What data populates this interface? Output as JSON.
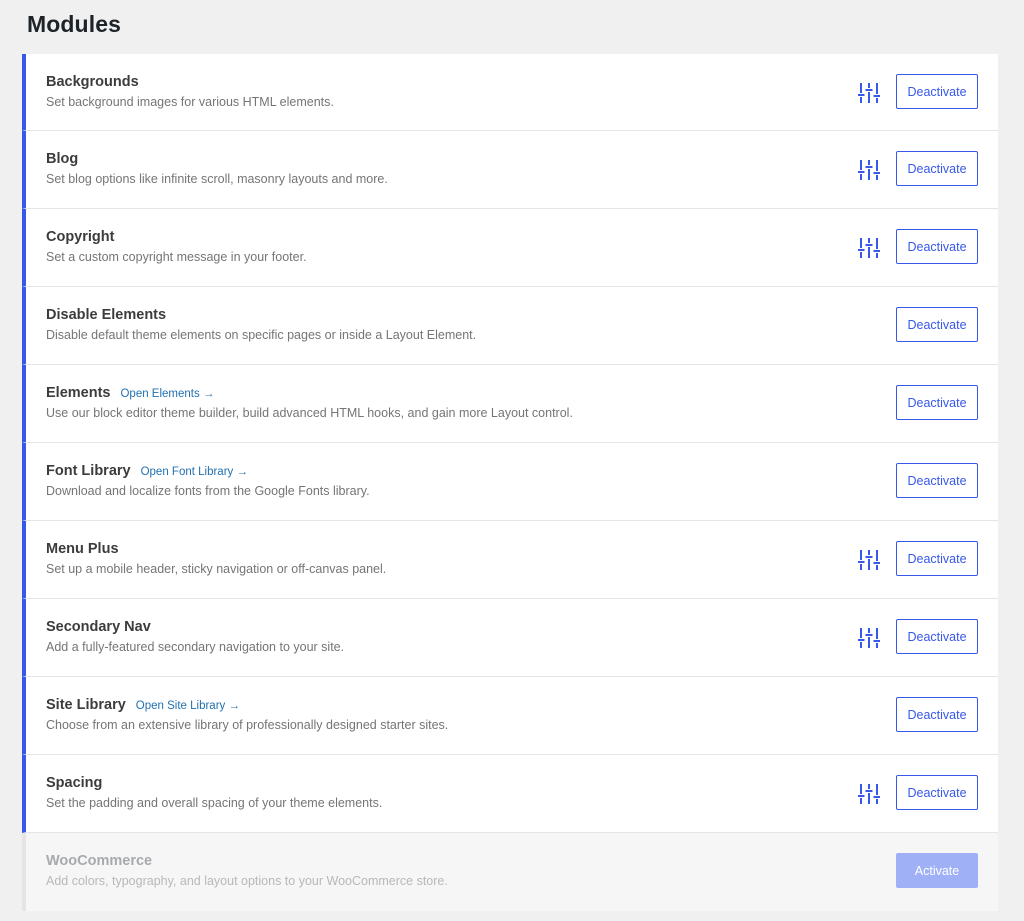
{
  "page": {
    "title": "Modules"
  },
  "colors": {
    "accent": "#3858e9",
    "inactive_button": "#9fb0f7",
    "link": "#2271b1"
  },
  "modules": [
    {
      "name": "Backgrounds",
      "description": "Set background images for various HTML elements.",
      "link": "",
      "has_settings": true,
      "active": true,
      "button": "Deactivate"
    },
    {
      "name": "Blog",
      "description": "Set blog options like infinite scroll, masonry layouts and more.",
      "link": "",
      "has_settings": true,
      "active": true,
      "button": "Deactivate"
    },
    {
      "name": "Copyright",
      "description": "Set a custom copyright message in your footer.",
      "link": "",
      "has_settings": true,
      "active": true,
      "button": "Deactivate"
    },
    {
      "name": "Disable Elements",
      "description": "Disable default theme elements on specific pages or inside a Layout Element.",
      "link": "",
      "has_settings": false,
      "active": true,
      "button": "Deactivate"
    },
    {
      "name": "Elements",
      "description": "Use our block editor theme builder, build advanced HTML hooks, and gain more Layout control.",
      "link": "Open Elements →",
      "has_settings": false,
      "active": true,
      "button": "Deactivate"
    },
    {
      "name": "Font Library",
      "description": "Download and localize fonts from the Google Fonts library.",
      "link": "Open Font Library →",
      "has_settings": false,
      "active": true,
      "button": "Deactivate"
    },
    {
      "name": "Menu Plus",
      "description": "Set up a mobile header, sticky navigation or off-canvas panel.",
      "link": "",
      "has_settings": true,
      "active": true,
      "button": "Deactivate"
    },
    {
      "name": "Secondary Nav",
      "description": "Add a fully-featured secondary navigation to your site.",
      "link": "",
      "has_settings": true,
      "active": true,
      "button": "Deactivate"
    },
    {
      "name": "Site Library",
      "description": "Choose from an extensive library of professionally designed starter sites.",
      "link": "Open Site Library →",
      "has_settings": false,
      "active": true,
      "button": "Deactivate"
    },
    {
      "name": "Spacing",
      "description": "Set the padding and overall spacing of your theme elements.",
      "link": "",
      "has_settings": true,
      "active": true,
      "button": "Deactivate"
    },
    {
      "name": "WooCommerce",
      "description": "Add colors, typography, and layout options to your WooCommerce store.",
      "link": "",
      "has_settings": false,
      "active": false,
      "button": "Activate"
    }
  ]
}
